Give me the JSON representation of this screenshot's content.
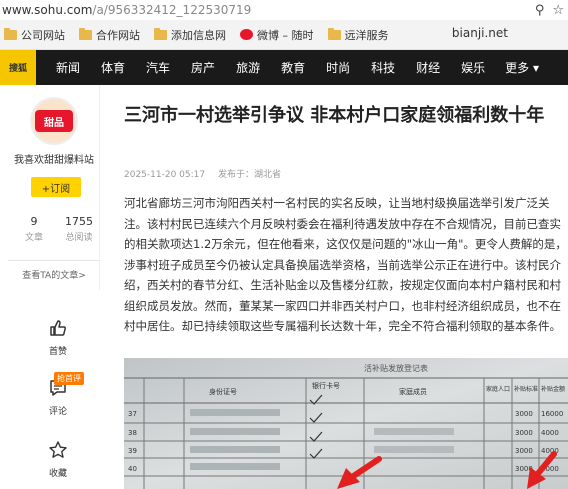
{
  "browser": {
    "url_host": "www.sohu.com",
    "url_path": "/a/956332412_122530719",
    "bookmarks": [
      "公司网站",
      "合作网站",
      "添加信息网",
      "微博 – 随时",
      "远洋服务"
    ],
    "bookmark_right": "bianji.net"
  },
  "nav": {
    "logo": "搜狐",
    "items": [
      "新闻",
      "体育",
      "汽车",
      "房产",
      "旅游",
      "教育",
      "时尚",
      "科技",
      "财经",
      "娱乐"
    ],
    "more": "更多 ▾"
  },
  "author": {
    "avatar_text": "甜品",
    "name": "我喜欢甜甜爆料站",
    "follow": "+订阅",
    "articles_count": "9",
    "articles_label": "文章",
    "reads_count": "1755",
    "reads_label": "总阅读",
    "see_articles": "查看TA的文章>"
  },
  "actions": {
    "like": "首赞",
    "comment": "评论",
    "comment_badge": "抢首评",
    "favorite": "收藏"
  },
  "article": {
    "title": "三河市一村选举引争议 非本村户口家庭领福利数十年",
    "date": "2025-11-20 05:17",
    "source": "发布于：湖北省",
    "body": "河北省廊坊三河市泃阳西关村一名村民的实名反映，让当地村级换届选举引发广泛关注。该村村民已连续六个月反映村委会在福利待遇发放中存在不合规情况，目前已查实的相关款项达1.2万余元，但在他看来，这仅仅是问题的\"冰山一角\"。更令人费解的是，涉事村班子成员至今仍被认定具备换届选举资格，当前选举公示正在进行中。该村民介绍，西关村的春节分红、生活补贴金以及售楼分红款，按规定仅面向本村户籍村民和村组织成员发放。然而，董某某一家四口并非西关村户口，也非村经济组织成员，也不在村中居住。却已持续领取这些专属福利长达数十年，完全不符合福利领取的基本条件。"
  },
  "photo": {
    "header_text": "活补贴发放登记表",
    "col_idcard": "身份证号",
    "col_bank": "银行卡号",
    "col_members": "家庭成员",
    "col_count": "家庭人口",
    "col_standard": "补贴标准",
    "col_amount": "补贴金额",
    "row_nums": [
      "37",
      "38",
      "39",
      "40"
    ],
    "amounts": [
      "16000",
      "4000",
      "4000",
      "8000"
    ],
    "standards": [
      "3000",
      "3000",
      "3000",
      "3000"
    ]
  }
}
